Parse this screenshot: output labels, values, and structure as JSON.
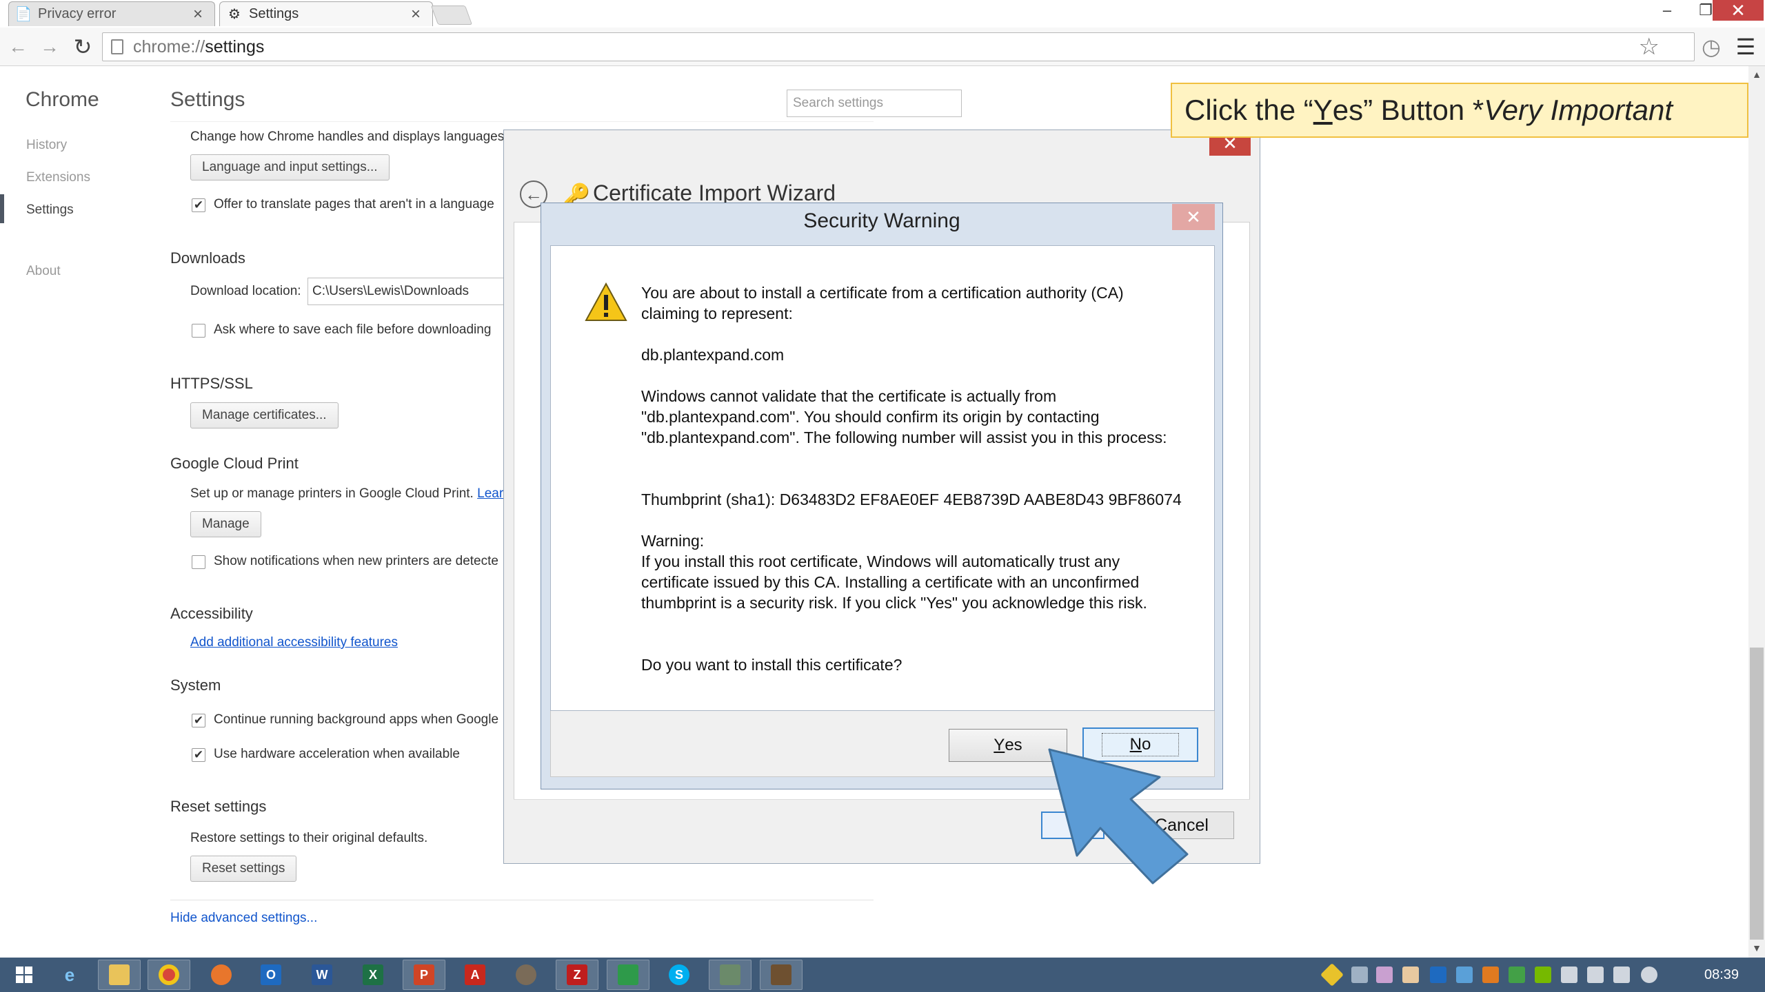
{
  "browser": {
    "tabs": [
      {
        "title": "Privacy error",
        "active": false
      },
      {
        "title": "Settings",
        "active": true
      }
    ],
    "address": {
      "scheme": "chrome://",
      "host": "settings"
    }
  },
  "sidebar": {
    "brand": "Chrome",
    "items": [
      {
        "label": "History"
      },
      {
        "label": "Extensions"
      },
      {
        "label": "Settings"
      },
      {
        "label": "About"
      }
    ]
  },
  "settings": {
    "title": "Settings",
    "search_placeholder": "Search settings",
    "languages": {
      "desc": "Change how Chrome handles and displays languages.",
      "button": "Language and input settings...",
      "translate_label": "Offer to translate pages that aren't in a language"
    },
    "downloads": {
      "title": "Downloads",
      "location_label": "Download location:",
      "location_value": "C:\\Users\\Lewis\\Downloads",
      "ask_label": "Ask where to save each file before downloading"
    },
    "https": {
      "title": "HTTPS/SSL",
      "button": "Manage certificates..."
    },
    "cloud_print": {
      "title": "Google Cloud Print",
      "desc": "Set up or manage printers in Google Cloud Print.",
      "learn": "Lear",
      "button": "Manage",
      "notify_label": "Show notifications when new printers are detecte"
    },
    "accessibility": {
      "title": "Accessibility",
      "link": "Add additional accessibility features"
    },
    "system": {
      "title": "System",
      "background_label": "Continue running background apps when Google",
      "hw_label": "Use hardware acceleration when available"
    },
    "reset": {
      "title": "Reset settings",
      "desc": "Restore settings to their original defaults.",
      "button": "Reset settings"
    },
    "hide_link": "Hide advanced settings..."
  },
  "wizard": {
    "title": "Certificate Import Wizard",
    "cancel": "Cancel"
  },
  "security_warning": {
    "title": "Security Warning",
    "para1": "You are about to install a certificate from a certification authority (CA) claiming to represent:",
    "domain": "db.plantexpand.com",
    "para2": "Windows cannot validate that the certificate is actually from \"db.plantexpand.com\". You should confirm its origin by contacting \"db.plantexpand.com\". The following number will assist you in this process:",
    "thumbprint": "Thumbprint (sha1): D63483D2 EF8AE0EF 4EB8739D AABE8D43 9BF86074",
    "warning_head": "Warning:",
    "warning_body": "If you install this root certificate, Windows will automatically trust any certificate issued by this CA. Installing a certificate with an unconfirmed thumbprint is a security risk. If you click \"Yes\" you acknowledge this risk.",
    "question": "Do you want to install this certificate?",
    "yes_first": "Y",
    "yes_rest": "es",
    "no_first": "N",
    "no_rest": "o"
  },
  "callout": {
    "pre": "Click the “",
    "underlined": "Y",
    "mid": "es” Button *",
    "emphasis": "Very Important"
  },
  "taskbar": {
    "clock": "08:39"
  },
  "colors": {
    "taskbar": "#3f5a78",
    "callout_bg": "#fff3c2",
    "callout_border": "#f0c040",
    "arrow": "#5b9bd5",
    "link": "#1155cc",
    "close_red": "#c7463e"
  }
}
